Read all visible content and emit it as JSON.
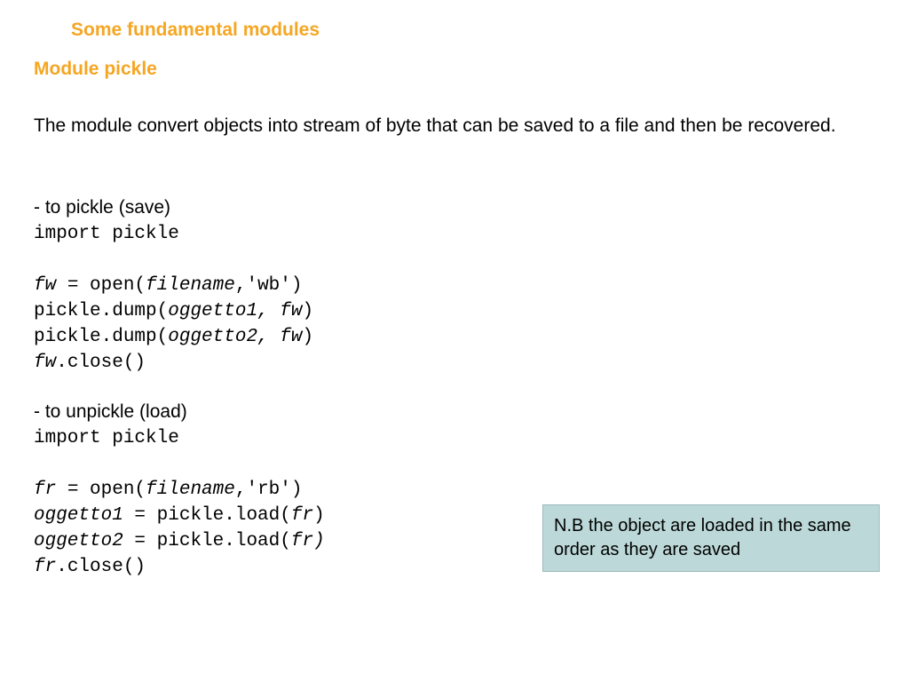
{
  "slide": {
    "title": "Some fundamental modules",
    "module_heading": "Module pickle",
    "description": "The module convert objects into stream of byte that can be saved to a file and then be recovered.",
    "pickle_label": "- to pickle (save)",
    "unpickle_label": "- to unpickle (load)",
    "code_pickle": {
      "l1": "import pickle",
      "l2_a": "fw",
      "l2_b": " = open(",
      "l2_c": "filename",
      "l2_d": ",'wb')",
      "l3_a": "pickle.dump(",
      "l3_b": "oggetto1, fw",
      "l3_c": ")",
      "l4_a": "pickle.dump(",
      "l4_b": "oggetto2, fw",
      "l4_c": ")",
      "l5_a": "fw",
      "l5_b": ".close()"
    },
    "code_unpickle": {
      "l1": "import pickle",
      "l2_a": "fr",
      "l2_b": " = open(",
      "l2_c": "filename",
      "l2_d": ",'rb')",
      "l3_a": "oggetto1",
      "l3_b": " = pickle.load(",
      "l3_c": "fr",
      "l3_d": ")",
      "l4_a": "oggetto2",
      "l4_b": " = pickle.load(",
      "l4_c": "fr)",
      "l5_a": "fr",
      "l5_b": ".close()"
    },
    "note": "N.B the object are loaded in the same order as they are saved"
  }
}
